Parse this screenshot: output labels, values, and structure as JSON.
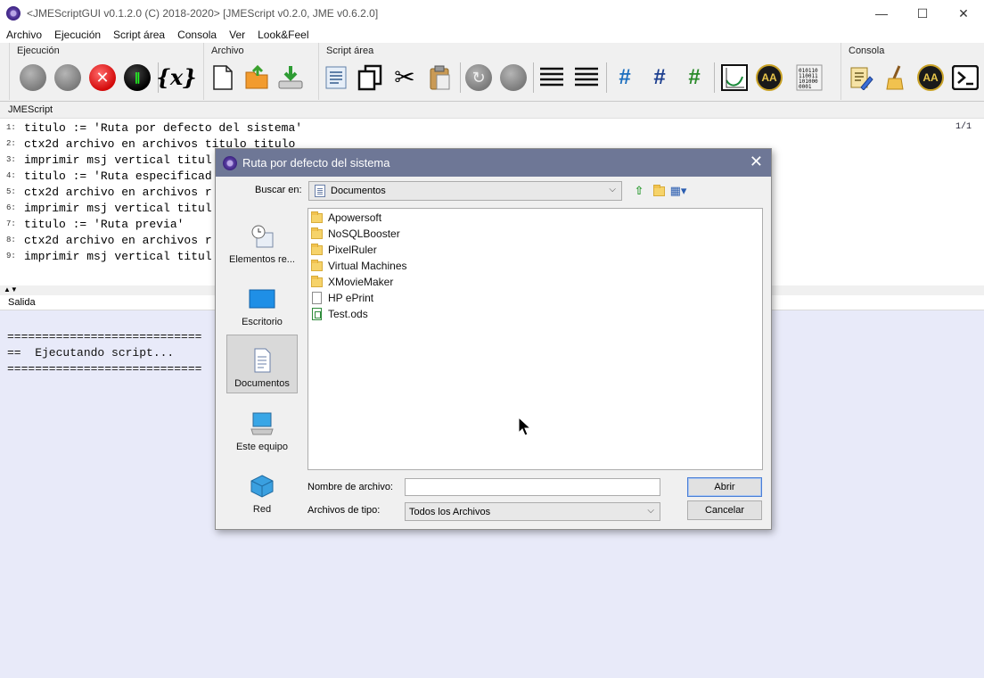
{
  "window": {
    "title": "<JMEScriptGUI v0.1.2.0  (C) 2018-2020>     [JMEScript v0.2.0, JME v0.6.2.0]",
    "controls": [
      "—",
      "☐",
      "✕"
    ]
  },
  "menu": [
    "Archivo",
    "Ejecución",
    "Script área",
    "Consola",
    "Ver",
    "Look&Feel"
  ],
  "toolbar": {
    "groups": [
      "Ejecución",
      "Archivo",
      "Script área",
      "Consola"
    ],
    "ejecucion_x": "x",
    "aa_label": "AA"
  },
  "editor": {
    "header": "JMEScript",
    "page": "1/1",
    "lines": [
      {
        "n": "1:",
        "text": "titulo := 'Ruta por defecto del sistema'"
      },
      {
        "n": "2:",
        "text": "ctx2d archivo en archivos titulo titulo"
      },
      {
        "n": "3:",
        "text": "imprimir msj vertical titul"
      },
      {
        "n": "4:",
        "text": "titulo := 'Ruta especificad"
      },
      {
        "n": "5:",
        "text": "ctx2d archivo en archivos r"
      },
      {
        "n": "6:",
        "text": "imprimir msj vertical titul"
      },
      {
        "n": "7:",
        "text": "titulo := 'Ruta previa'"
      },
      {
        "n": "8:",
        "text": "ctx2d archivo en archivos r"
      },
      {
        "n": "9:",
        "text": "imprimir msj vertical titul"
      }
    ]
  },
  "output": {
    "header": "Salida",
    "lines": [
      "============================",
      "==  Ejecutando script...",
      "============================"
    ]
  },
  "dialog": {
    "title": "Ruta por defecto del sistema",
    "close": "✕",
    "look_in_label": "Buscar en:",
    "look_in_value": "Documentos",
    "places": [
      "Elementos re...",
      "Escritorio",
      "Documentos",
      "Este equipo",
      "Red"
    ],
    "files": [
      {
        "name": "Apowersoft",
        "type": "folder"
      },
      {
        "name": "NoSQLBooster",
        "type": "folder"
      },
      {
        "name": "PixelRuler",
        "type": "folder"
      },
      {
        "name": "Virtual Machines",
        "type": "folder"
      },
      {
        "name": "XMovieMaker",
        "type": "folder"
      },
      {
        "name": "HP ePrint",
        "type": "file"
      },
      {
        "name": "Test.ods",
        "type": "ods"
      }
    ],
    "filename_label": "Nombre de archivo:",
    "filename_value": "",
    "filetype_label": "Archivos de tipo:",
    "filetype_value": "Todos los Archivos",
    "open_button": "Abrir",
    "cancel_button": "Cancelar"
  },
  "colors": {
    "dialog_title_bg": "#6e7796",
    "output_bg": "#e8eaf9"
  }
}
